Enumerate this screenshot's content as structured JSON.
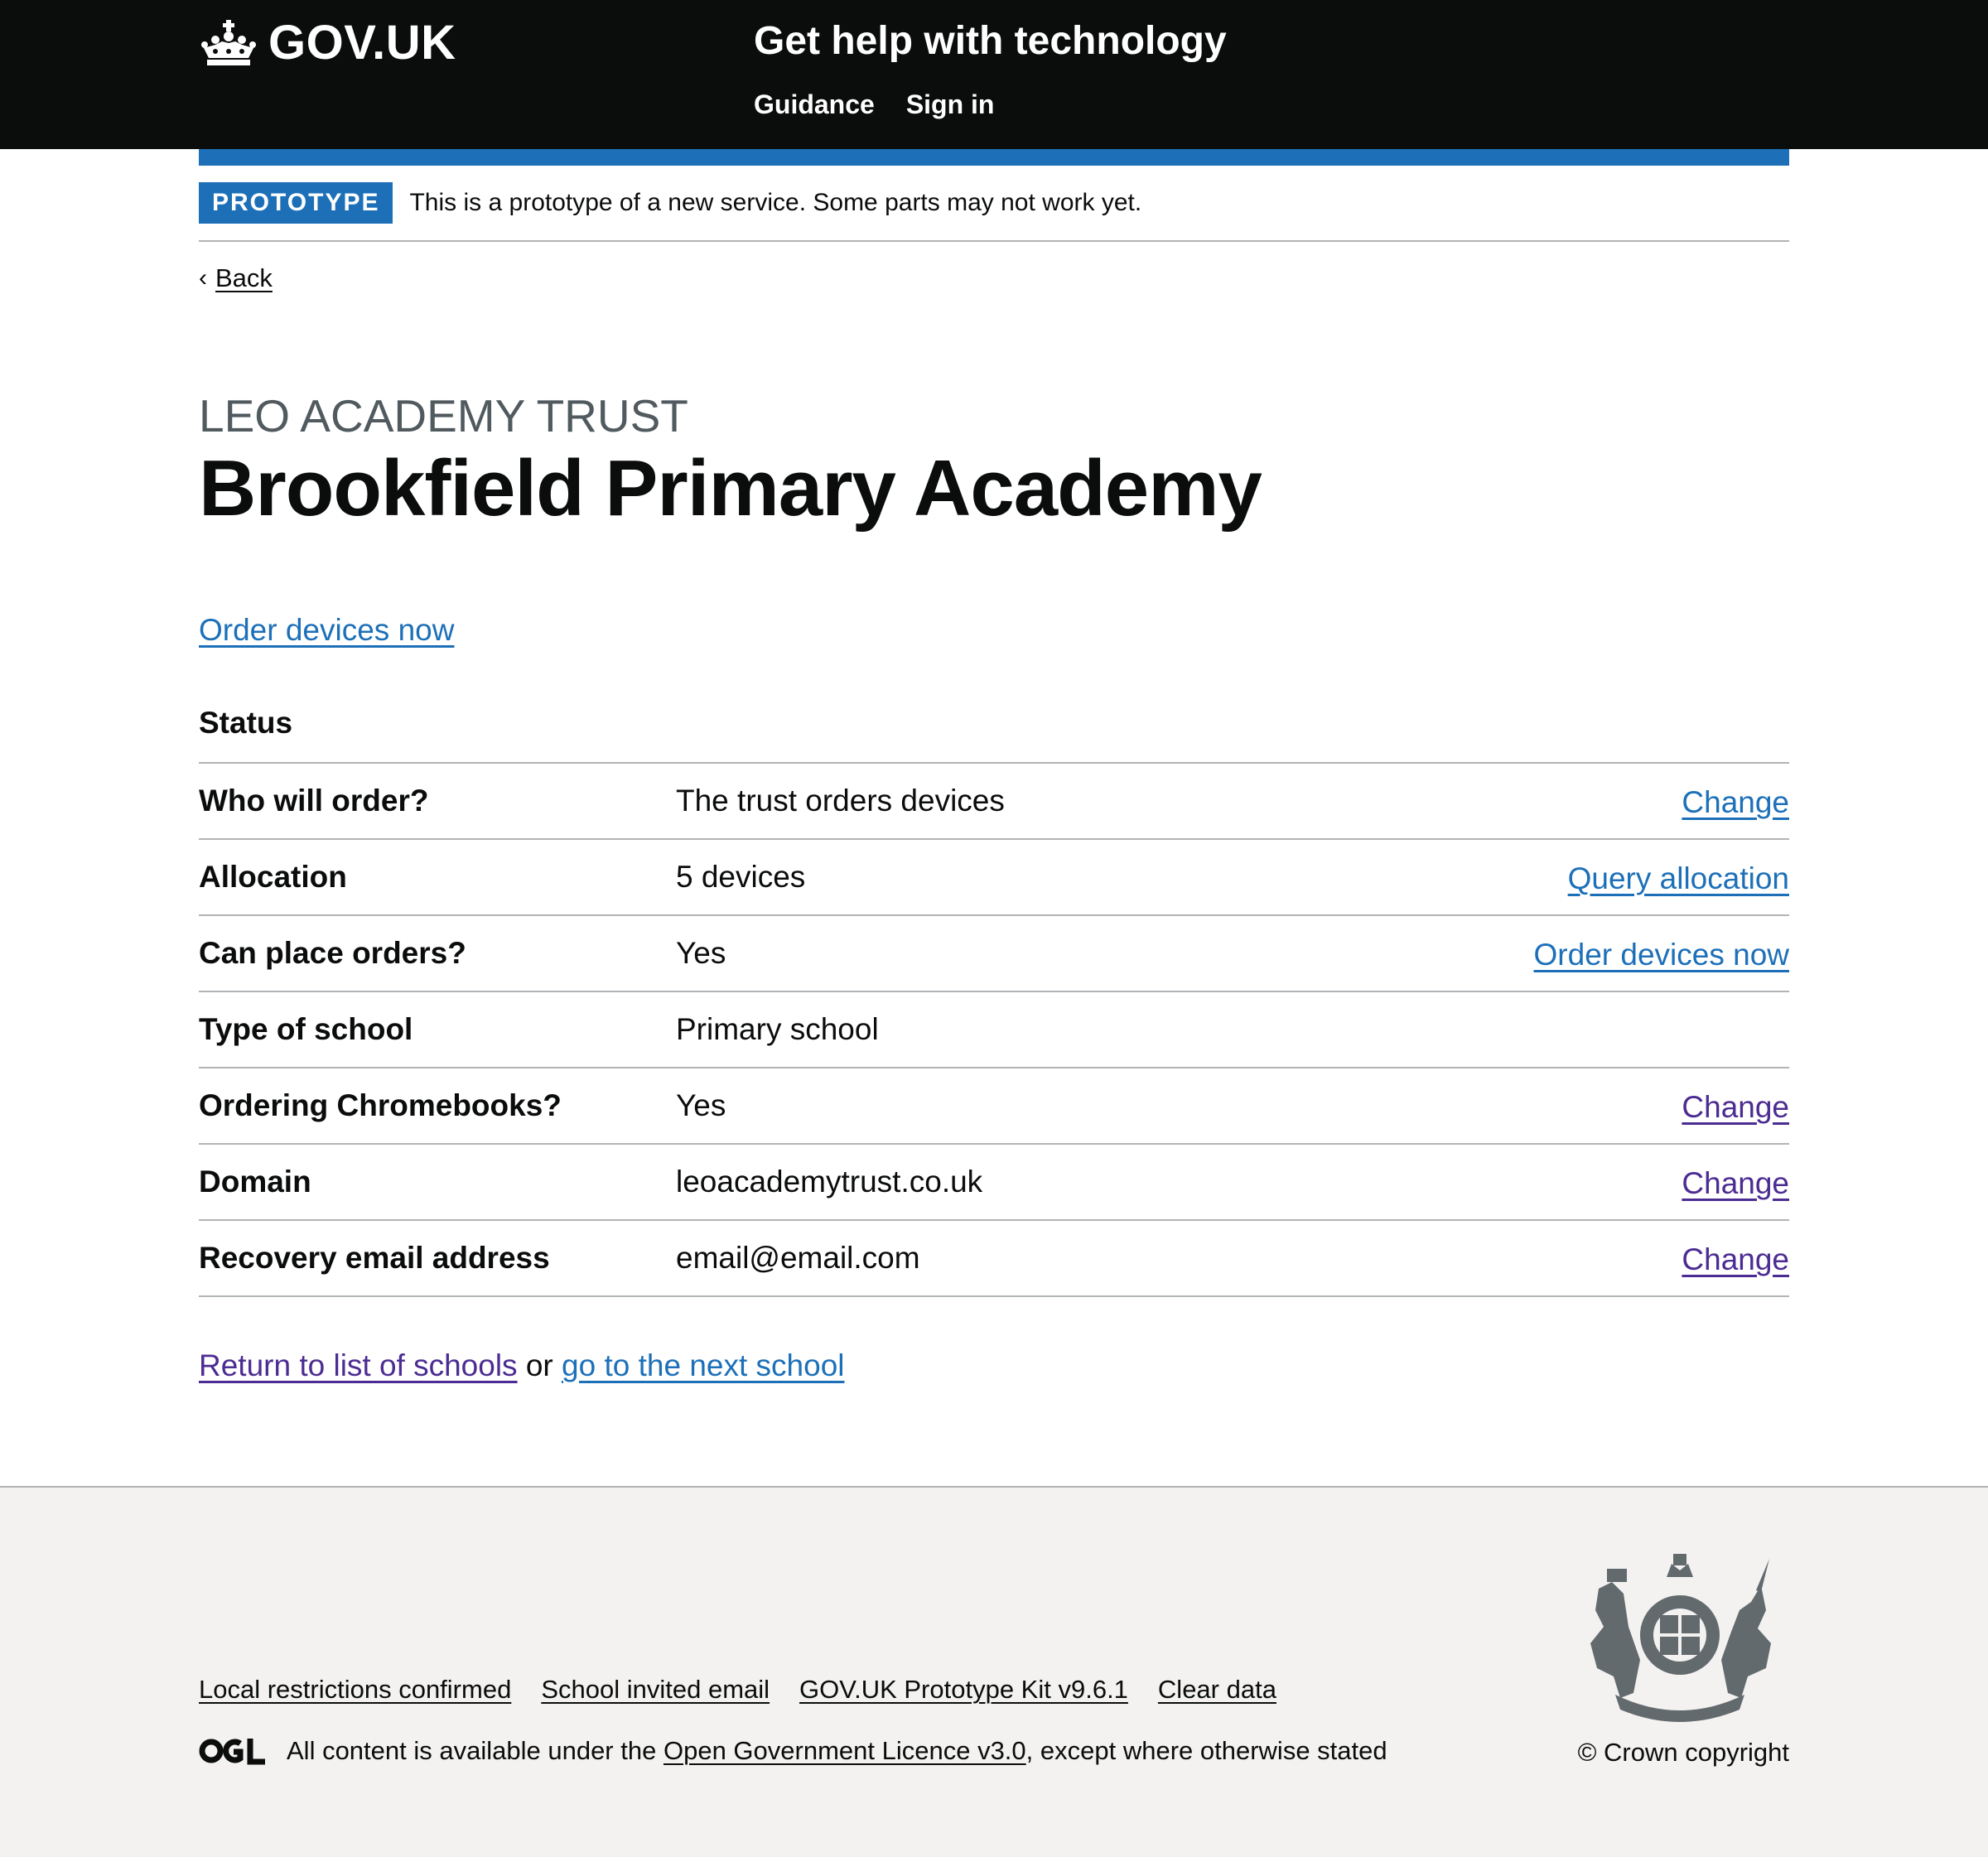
{
  "header": {
    "logo_text": "GOV.UK",
    "service_name": "Get help with technology",
    "nav": [
      "Guidance",
      "Sign in"
    ]
  },
  "phase_banner": {
    "tag": "PROTOTYPE",
    "text": "This is a prototype of a new service. Some parts may not work yet."
  },
  "back_link": "Back",
  "caption": "LEO ACADEMY TRUST",
  "title": "Brookfield Primary Academy",
  "order_link": "Order devices now",
  "status_heading": "Status",
  "rows": [
    {
      "key": "Who will order?",
      "value": "The trust orders devices",
      "action": "Change"
    },
    {
      "key": "Allocation",
      "value": "5 devices",
      "action": "Query allocation"
    },
    {
      "key": "Can place orders?",
      "value": "Yes",
      "action": "Order devices now"
    },
    {
      "key": "Type of school",
      "value": "Primary school",
      "action": ""
    },
    {
      "key": "Ordering Chromebooks?",
      "value": "Yes",
      "action": "Change"
    },
    {
      "key": "Domain",
      "value": "leoacademytrust.co.uk",
      "action": "Change"
    },
    {
      "key": "Recovery email address",
      "value": "email@email.com",
      "action": "Change"
    }
  ],
  "return_links": {
    "return_text": "Return to list of schools",
    "or_text": "or",
    "next_text": "go to the next school"
  },
  "footer": {
    "links": [
      "Local restrictions confirmed",
      "School invited email",
      "GOV.UK Prototype Kit v9.6.1",
      "Clear data"
    ],
    "licence_prefix": "All content is available under the",
    "licence_link": "Open Government Licence v3.0",
    "licence_suffix": ", except where otherwise stated",
    "copyright": "© Crown copyright"
  },
  "colors": {
    "header_bg": "#0b0c0c",
    "link": "#1d70b8",
    "visited_link": "#4c2c92",
    "footer_bg": "#f3f2f1",
    "border": "#b1b4b6"
  }
}
